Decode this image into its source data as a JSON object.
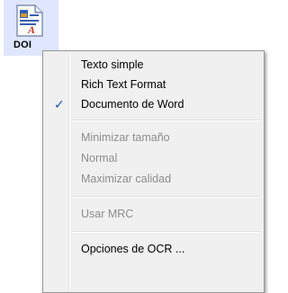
{
  "file": {
    "label": "DOI",
    "icon": "word-document-icon"
  },
  "menu": {
    "items": [
      {
        "label": "Texto simple",
        "checked": false,
        "enabled": true
      },
      {
        "label": "Rich Text Format",
        "checked": false,
        "enabled": true
      },
      {
        "label": "Documento de Word",
        "checked": true,
        "enabled": true
      },
      {
        "label": "Minimizar tamaño",
        "checked": false,
        "enabled": false
      },
      {
        "label": "Normal",
        "checked": false,
        "enabled": false
      },
      {
        "label": "Maximizar calidad",
        "checked": false,
        "enabled": false
      },
      {
        "label": "Usar MRC",
        "checked": false,
        "enabled": false
      },
      {
        "label": "Opciones de OCR ...",
        "checked": false,
        "enabled": true
      }
    ],
    "check_glyph": "✓",
    "colors": {
      "disabled_text": "#8d8d8d",
      "check": "#1b4fb5"
    }
  }
}
